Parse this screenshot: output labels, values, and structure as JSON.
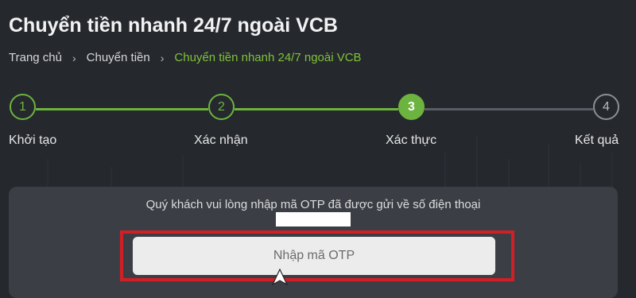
{
  "header": {
    "title": "Chuyển tiền nhanh 24/7 ngoài VCB"
  },
  "breadcrumb": {
    "items": [
      "Trang chủ",
      "Chuyển tiền",
      "Chuyển tiền nhanh 24/7 ngoài VCB"
    ],
    "separator": "›"
  },
  "stepper": {
    "current_step": 3,
    "steps": [
      {
        "number": "1",
        "label": "Khởi tạo",
        "state": "done"
      },
      {
        "number": "2",
        "label": "Xác nhận",
        "state": "done"
      },
      {
        "number": "3",
        "label": "Xác thực",
        "state": "current"
      },
      {
        "number": "4",
        "label": "Kết quả",
        "state": "todo"
      }
    ]
  },
  "otp": {
    "instruction": "Quý khách vui lòng nhập mã OTP đã được gửi về số điện thoại",
    "input_placeholder": "Nhập mã OTP",
    "input_value": ""
  },
  "colors": {
    "accent": "#6db33f",
    "background": "#25282d",
    "panel": "#3b3f45",
    "highlight": "#d11f25"
  },
  "icons": [
    "chevron-right-icon",
    "mouse-cursor-icon"
  ]
}
